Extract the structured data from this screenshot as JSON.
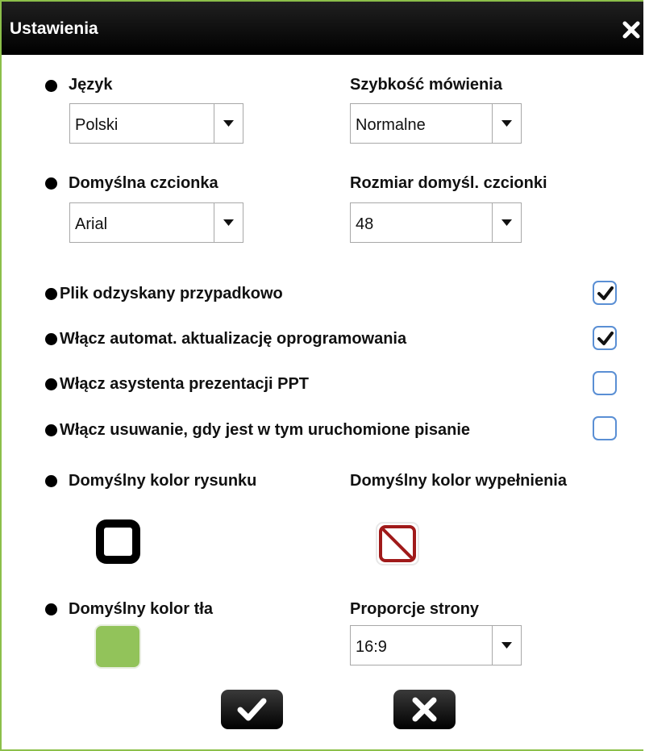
{
  "dialog": {
    "title": "Ustawienia"
  },
  "language": {
    "label": "Język",
    "value": "Polski"
  },
  "speech_speed": {
    "label": "Szybkość mówienia",
    "value": "Normalne"
  },
  "default_font": {
    "label": "Domyślna czcionka",
    "value": "Arial"
  },
  "default_font_size": {
    "label": "Rozmiar domyśl. czcionki",
    "value": "48"
  },
  "options": [
    {
      "label": "Plik odzyskany przypadkowo",
      "checked": true
    },
    {
      "label": "Włącz automat. aktualizację oprogramowania",
      "checked": true
    },
    {
      "label": "Włącz asystenta prezentacji PPT",
      "checked": false
    },
    {
      "label": "Włącz usuwanie, gdy jest w tym uruchomione pisanie",
      "checked": false
    }
  ],
  "draw_color": {
    "label": "Domyślny kolor rysunku",
    "color": "#000000"
  },
  "fill_color": {
    "label": "Domyślny kolor wypełnienia",
    "color": "none"
  },
  "background_color": {
    "label": "Domyślny kolor tła",
    "color": "#92c35a"
  },
  "aspect_ratio": {
    "label": "Proporcje strony",
    "value": "16:9"
  },
  "colors": {
    "accent": "#8cbf4a",
    "checkbox_border": "#5a8fd4",
    "no_fill": "#a01a1a"
  },
  "icons": {
    "close": "close-icon",
    "confirm": "check-icon",
    "cancel": "x-icon"
  }
}
